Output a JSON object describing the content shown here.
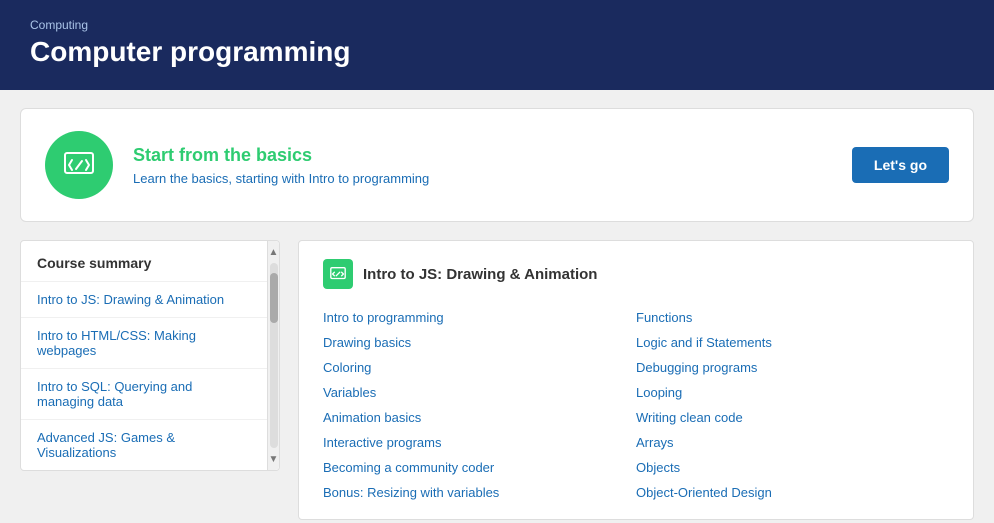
{
  "header": {
    "subtitle": "Computing",
    "title": "Computer programming"
  },
  "banner": {
    "heading": "Start from the basics",
    "description_start": "Learn the basics, starting with ",
    "description_link": "Intro to programming",
    "button_label": "Let's go"
  },
  "sidebar": {
    "title": "Course summary",
    "items": [
      {
        "label": "Intro to JS: Drawing & Animation"
      },
      {
        "label": "Intro to HTML/CSS: Making webpages"
      },
      {
        "label": "Intro to SQL: Querying and managing data"
      },
      {
        "label": "Advanced JS: Games & Visualizations"
      }
    ]
  },
  "course": {
    "title": "Intro to JS: Drawing & Animation",
    "links_left": [
      "Intro to programming",
      "Drawing basics",
      "Coloring",
      "Variables",
      "Animation basics",
      "Interactive programs",
      "Becoming a community coder",
      "Bonus: Resizing with variables"
    ],
    "links_right": [
      "Functions",
      "Logic and if Statements",
      "Debugging programs",
      "Looping",
      "Writing clean code",
      "Arrays",
      "Objects",
      "Object-Oriented Design"
    ]
  }
}
